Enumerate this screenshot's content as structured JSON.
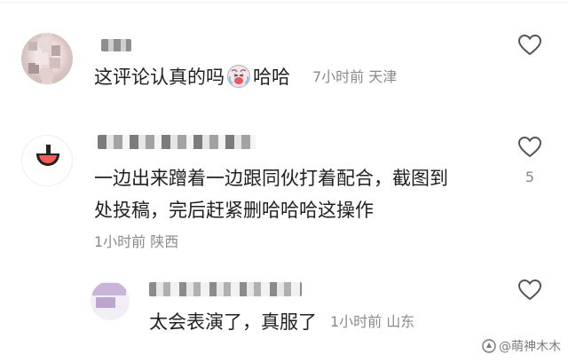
{
  "comments": [
    {
      "text_before": "这评论认真的吗",
      "emoji": "crying-laughing-face-icon",
      "text_after": "哈哈",
      "time": "7小时前",
      "location": "天津"
    },
    {
      "line1": "一边出来蹭着一边跟同伙打着配合，截图到",
      "line2": "处投稿，完后赶紧删哈哈哈这操作",
      "time": "1小时前",
      "location": "陕西",
      "likes": "5"
    },
    {
      "text": "太会表演了，真服了",
      "time": "1小时前",
      "location": "山东"
    }
  ],
  "watermark": "@萌神木木",
  "icons": {
    "like": "heart-outline-icon",
    "watermark_badge": "weibo-badge-icon"
  },
  "colors": {
    "text": "#1f1f1f",
    "meta": "#8a8a8a",
    "icon": "#555555"
  }
}
